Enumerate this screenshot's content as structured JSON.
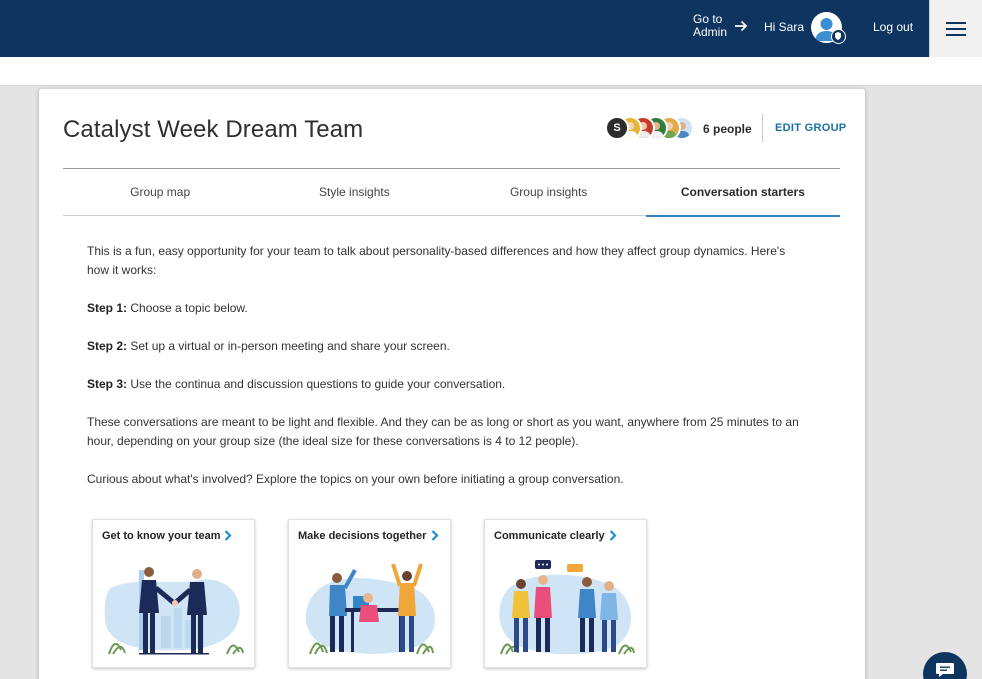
{
  "header": {
    "goto_line1": "Go to",
    "goto_line2": "Admin",
    "greeting": "Hi Sara",
    "logout": "Log out"
  },
  "group": {
    "title": "Catalyst Week Dream Team",
    "people_count": "6 people",
    "first_avatar_initial": "S",
    "edit_label": "EDIT GROUP"
  },
  "tabs": [
    {
      "label": "Group map"
    },
    {
      "label": "Style insights"
    },
    {
      "label": "Group insights"
    },
    {
      "label": "Conversation starters"
    }
  ],
  "content": {
    "intro": "This is a fun, easy opportunity for your team to talk about personality-based differences and how they affect group dynamics. Here's how it works:",
    "step1_label": "Step 1:",
    "step1_text": " Choose a topic below.",
    "step2_label": "Step 2:",
    "step2_text": " Set up a virtual or in-person meeting and share your screen.",
    "step3_label": "Step 3:",
    "step3_text": " Use the continua and discussion questions to guide your conversation.",
    "note": "These conversations are meant to be light and flexible. And they can be as long or short as you want, anywhere from 25 minutes to an hour, depending on your group size (the ideal size for these conversations is 4 to 12 people).",
    "curious": "Curious about what's involved? Explore the topics on your own before initiating a group conversation."
  },
  "topics": [
    {
      "label": "Get to know your team"
    },
    {
      "label": "Make decisions together"
    },
    {
      "label": "Communicate clearly"
    }
  ],
  "colors": {
    "header_bg": "#0e3460",
    "accent": "#2f86c9",
    "link": "#1b6fa8"
  }
}
